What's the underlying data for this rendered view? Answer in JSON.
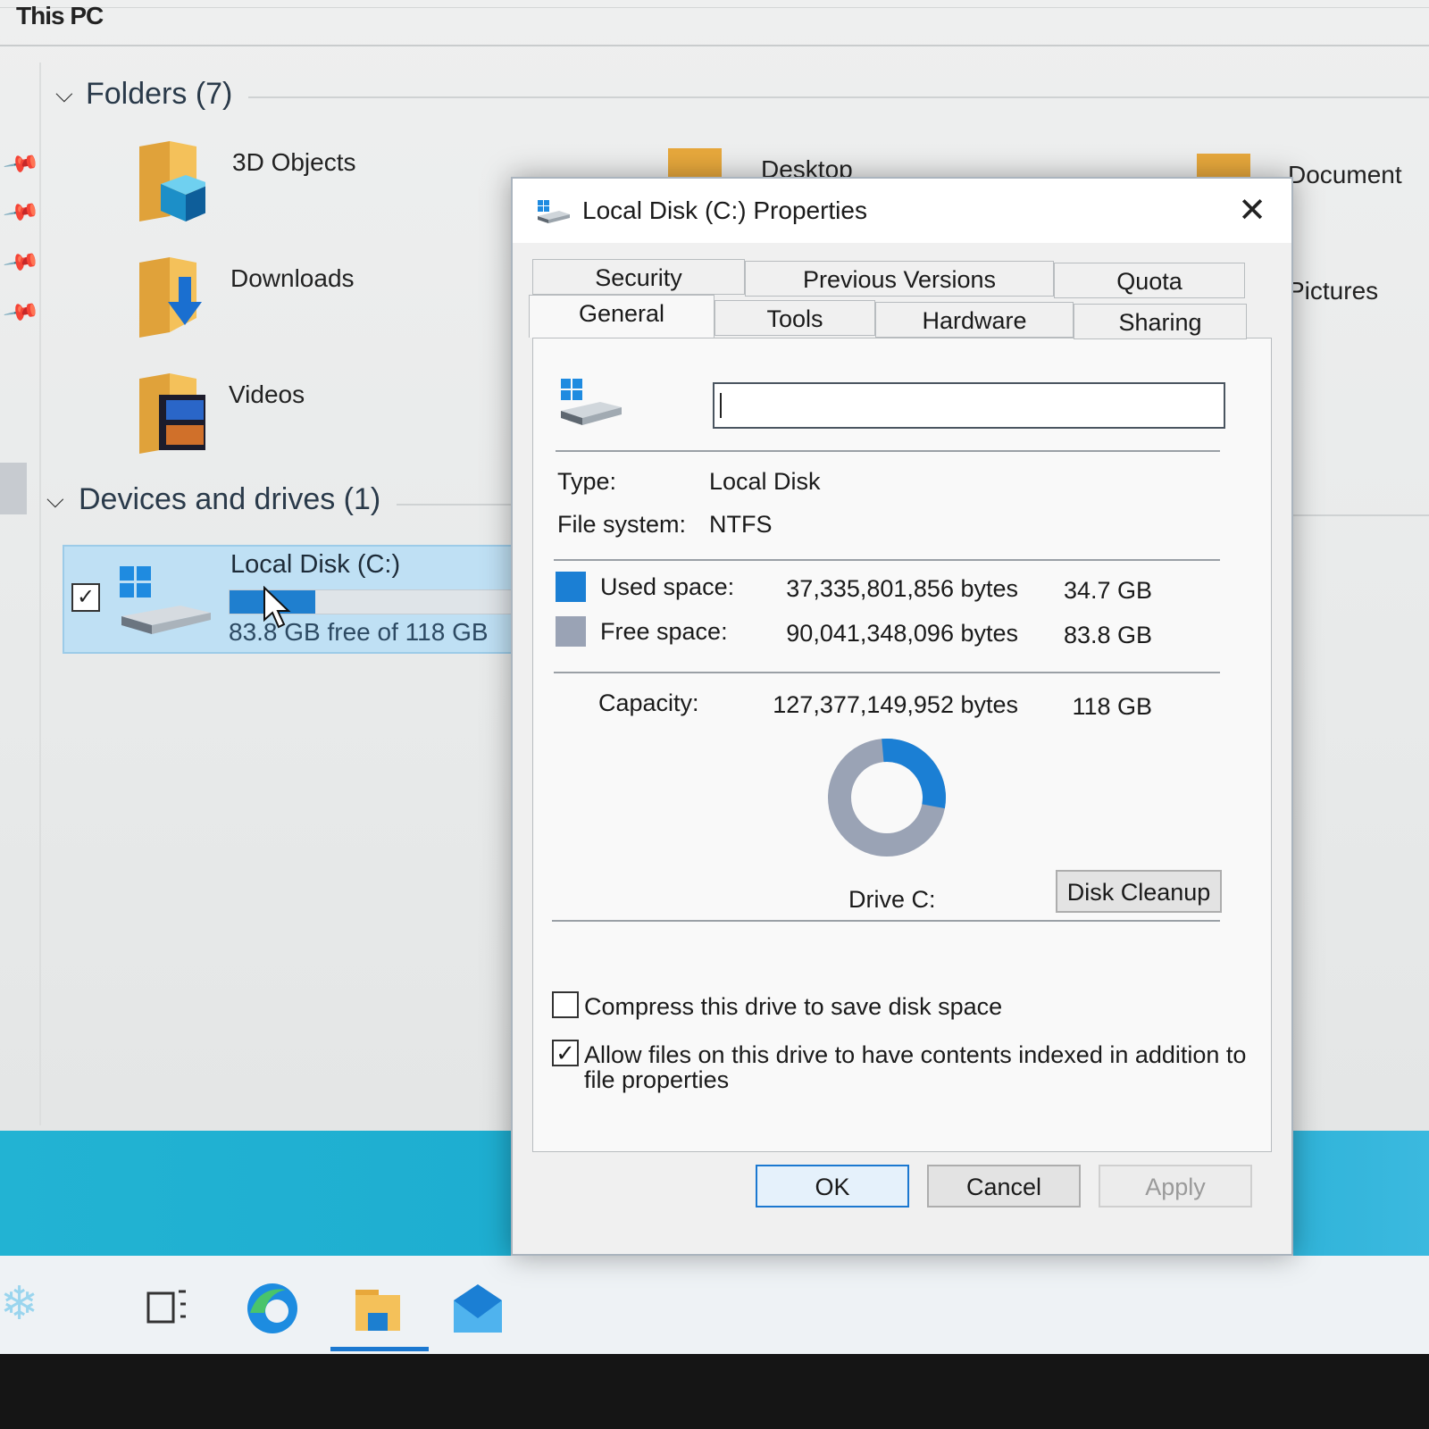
{
  "explorer": {
    "breadcrumb": "This PC",
    "folders_group": "Folders (7)",
    "drives_group": "Devices and drives (1)",
    "folders": [
      {
        "label": "3D Objects",
        "icon": "3d-objects-folder-icon"
      },
      {
        "label": "Downloads",
        "icon": "downloads-folder-icon"
      },
      {
        "label": "Videos",
        "icon": "videos-folder-icon"
      },
      {
        "label": "Desktop",
        "icon": "desktop-folder-icon"
      },
      {
        "label": "Document",
        "icon": "documents-folder-icon"
      },
      {
        "label": "Pictures",
        "icon": "pictures-folder-icon"
      }
    ],
    "drive": {
      "name": "Local Disk (C:)",
      "free_text": "83.8 GB free of 118 GB",
      "used_fraction": 0.29,
      "checked": true
    }
  },
  "dialog": {
    "title": "Local Disk (C:) Properties",
    "close": "✕",
    "tabs_row1": [
      "Security",
      "Previous Versions",
      "Quota"
    ],
    "tabs_row2": [
      "General",
      "Tools",
      "Hardware",
      "Sharing"
    ],
    "active_tab": "General",
    "volume_label_value": "",
    "type_label": "Type:",
    "type_value": "Local Disk",
    "fs_label": "File system:",
    "fs_value": "NTFS",
    "used_label": "Used space:",
    "used_bytes": "37,335,801,856 bytes",
    "used_gb": "34.7 GB",
    "free_label": "Free space:",
    "free_bytes": "90,041,348,096 bytes",
    "free_gb": "83.8 GB",
    "capacity_label": "Capacity:",
    "capacity_bytes": "127,377,149,952 bytes",
    "capacity_gb": "118 GB",
    "drive_label": "Drive C:",
    "cleanup_button": "Disk Cleanup",
    "compress_label": "Compress this drive to save disk space",
    "compress_checked": false,
    "index_label_line1": "Allow files on this drive to have contents indexed in addition to",
    "index_label_line2": "file properties",
    "index_checked": true,
    "ok": "OK",
    "cancel": "Cancel",
    "apply": "Apply",
    "used_fraction": 0.293,
    "colors": {
      "used": "#1b7fd4",
      "free": "#9aa3b5"
    }
  },
  "taskbar": {
    "icons": [
      "task-view-icon",
      "edge-icon",
      "file-explorer-icon",
      "mail-icon"
    ]
  }
}
